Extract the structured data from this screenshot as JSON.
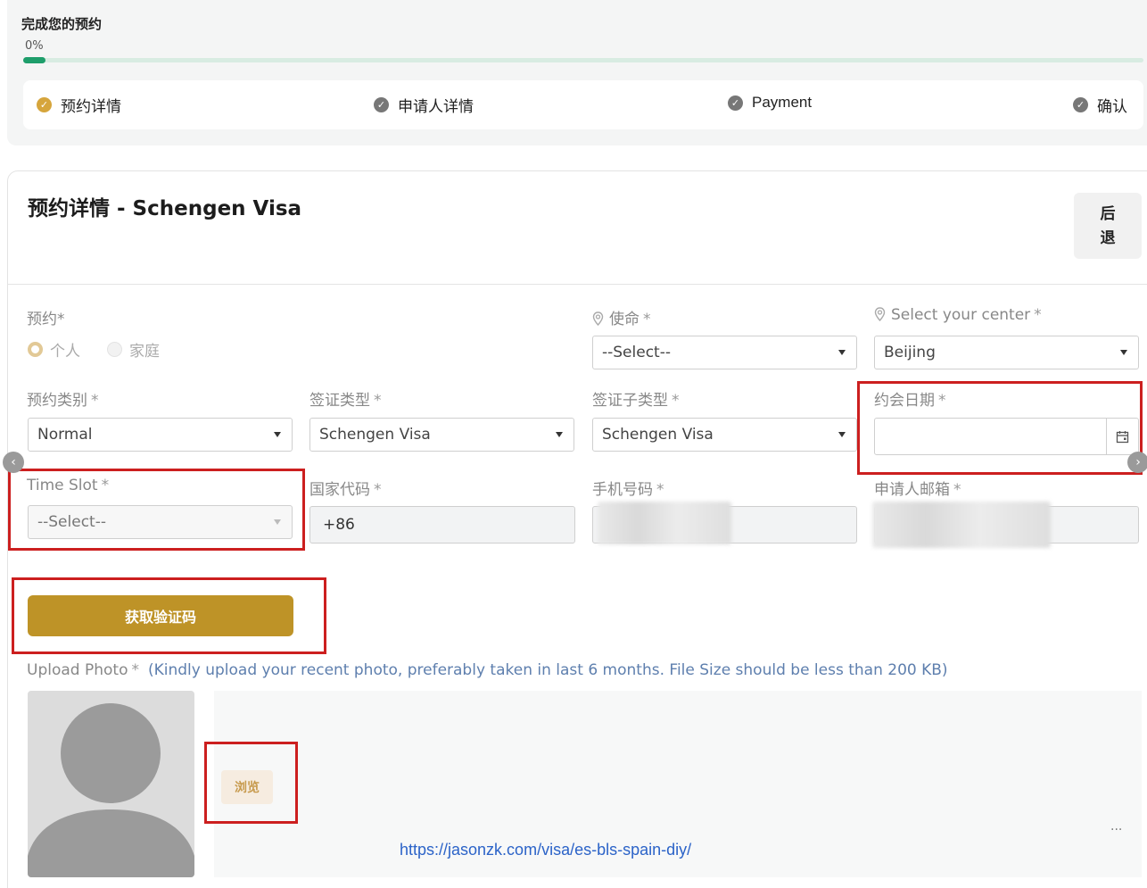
{
  "progress": {
    "title": "完成您的预约",
    "percent_label": "0%",
    "percent": 0.02
  },
  "steps": [
    {
      "label": "预约详情",
      "active": true
    },
    {
      "label": "申请人详情",
      "active": false
    },
    {
      "label": "Payment",
      "active": false
    },
    {
      "label": "确认",
      "active": false
    }
  ],
  "card": {
    "title": "预约详情 - Schengen Visa",
    "back_label_line1": "后",
    "back_label_line2": "退"
  },
  "form": {
    "appointment": {
      "label": "预约*",
      "options": [
        "个人",
        "家庭"
      ],
      "selected": "个人"
    },
    "mission": {
      "label": "使命",
      "value": "--Select--"
    },
    "center": {
      "label": "Select your center",
      "value": "Beijing"
    },
    "category": {
      "label": "预约类别",
      "value": "Normal"
    },
    "visa_type": {
      "label": "签证类型",
      "value": "Schengen Visa"
    },
    "visa_subtype": {
      "label": "签证子类型",
      "value": "Schengen Visa"
    },
    "date": {
      "label": "约会日期",
      "value": ""
    },
    "time_slot": {
      "label": "Time Slot",
      "value": "--Select--"
    },
    "country_code": {
      "label": "国家代码",
      "value": "+86"
    },
    "phone": {
      "label": "手机号码"
    },
    "email": {
      "label": "申请人邮箱"
    },
    "required_mark": "*",
    "otp_button": "获取验证码",
    "upload": {
      "label": "Upload Photo",
      "hint": "(Kindly upload your recent photo, preferably taken in last 6 months. File Size should be less than 200 KB)",
      "browse_label": "浏览"
    }
  },
  "overlay": {
    "url": "https://jasonzk.com/visa/es-bls-spain-diy/",
    "more": "..."
  },
  "colors": {
    "accent_gold": "#be9327",
    "progress_green": "#1e9e6b",
    "highlight_red": "#cc1f1f",
    "step_active": "#d6a53c"
  }
}
